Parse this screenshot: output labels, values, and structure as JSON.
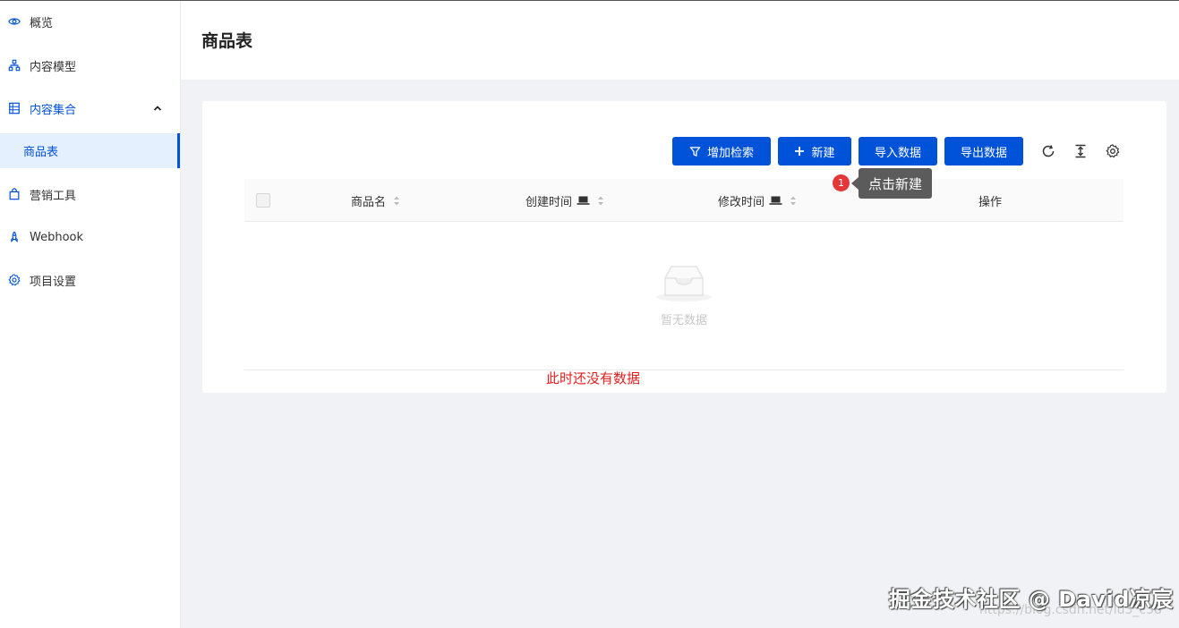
{
  "sidebar": {
    "items": [
      {
        "label": "概览",
        "icon": "eye-icon"
      },
      {
        "label": "内容模型",
        "icon": "sitemap-icon"
      },
      {
        "label": "内容集合",
        "icon": "list-icon",
        "expanded": true
      },
      {
        "label": "营销工具",
        "icon": "bag-icon"
      },
      {
        "label": "Webhook",
        "icon": "rocket-icon"
      },
      {
        "label": "项目设置",
        "icon": "gear-icon"
      }
    ],
    "sub_items": [
      {
        "label": "商品表",
        "active": true
      }
    ]
  },
  "header": {
    "title": "商品表"
  },
  "toolbar": {
    "search_label": "增加检索",
    "new_label": "新建",
    "import_label": "导入数据",
    "export_label": "导出数据",
    "icons": [
      "refresh-icon",
      "column-height-icon",
      "settings-icon"
    ]
  },
  "table": {
    "columns": [
      "商品名",
      "创建时间",
      "修改时间",
      "操作"
    ],
    "empty_text": "暂无数据"
  },
  "tooltip": {
    "badge": "1",
    "text": "点击新建"
  },
  "annotation": "此时还没有数据",
  "watermark": {
    "text": "掘金技术社区 @ David凉宸",
    "url": "https://blog.csdn.net/lu3_c38"
  },
  "colors": {
    "primary": "#0052d9",
    "active_bg": "#e5f0ff",
    "annotation": "#e02020",
    "badge": "#e5373a"
  }
}
